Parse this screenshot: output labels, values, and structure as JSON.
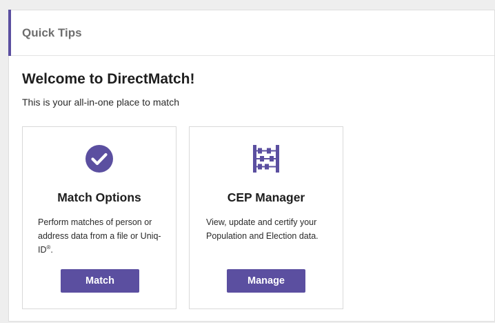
{
  "panel": {
    "title": "Quick Tips"
  },
  "welcome": {
    "heading": "Welcome to DirectMatch!",
    "subtitle": "This is your all-in-one place to match"
  },
  "cards": [
    {
      "icon": "check-circle-icon",
      "title": "Match Options",
      "desc_main": "Perform matches of person or address data from a file or Uniq-ID",
      "desc_sup": "®",
      "desc_end": ".",
      "button_label": "Match"
    },
    {
      "icon": "abacus-icon",
      "title": "CEP Manager",
      "desc": "View, update and certify your Population and Election data.",
      "button_label": "Manage"
    }
  ],
  "colors": {
    "accent": "#5b4fa0",
    "background": "#eeeeee",
    "panel": "#ffffff"
  }
}
